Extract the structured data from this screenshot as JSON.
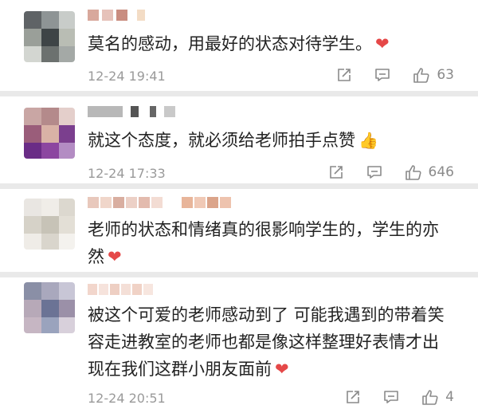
{
  "comments": [
    {
      "text": "莫名的感动，用最好的状态对待学生。",
      "emoji": "❤",
      "time": "12-24 19:41",
      "likes": "63"
    },
    {
      "text": "就这个态度，就必须给老师拍手点赞",
      "emoji": "👍",
      "time": "12-24 17:33",
      "likes": "646"
    },
    {
      "text": "老师的状态和情绪真的很影响学生的，学生的亦然",
      "emoji": "❤",
      "time": "",
      "likes": ""
    },
    {
      "text": "被这个可爱的老师感动到了 可能我遇到的带着笑容走进教室的老师也都是像这样整理好表情才出现在我们这群小朋友面前",
      "emoji": "❤",
      "time": "12-24 20:51",
      "likes": "4"
    }
  ],
  "icons": {
    "share": "share-icon",
    "comment": "comment-icon",
    "like": "like-icon",
    "heart": "heart-emoji",
    "thumbs_up": "thumbs-up-emoji"
  },
  "colors": {
    "heart": "#e54848",
    "meta": "#9a9a9a",
    "background": "#e9e9e9"
  }
}
